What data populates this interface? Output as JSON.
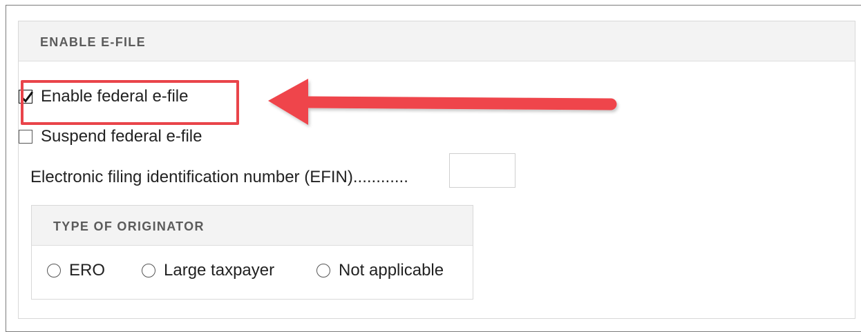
{
  "panel": {
    "title": "ENABLE E-FILE"
  },
  "options": {
    "enable_federal_efile": {
      "label": "Enable federal e-file",
      "checked": true
    },
    "suspend_federal_efile": {
      "label": "Suspend federal e-file",
      "checked": false
    }
  },
  "efin": {
    "label": "Electronic filing identification number (EFIN)............",
    "value": ""
  },
  "originator": {
    "title": "TYPE OF ORIGINATOR",
    "options": [
      {
        "label": "ERO",
        "selected": false
      },
      {
        "label": "Large taxpayer",
        "selected": false
      },
      {
        "label": "Not applicable",
        "selected": false
      }
    ]
  },
  "annotation": {
    "highlight_color": "#e9444a",
    "arrow_color": "#ef454b"
  }
}
